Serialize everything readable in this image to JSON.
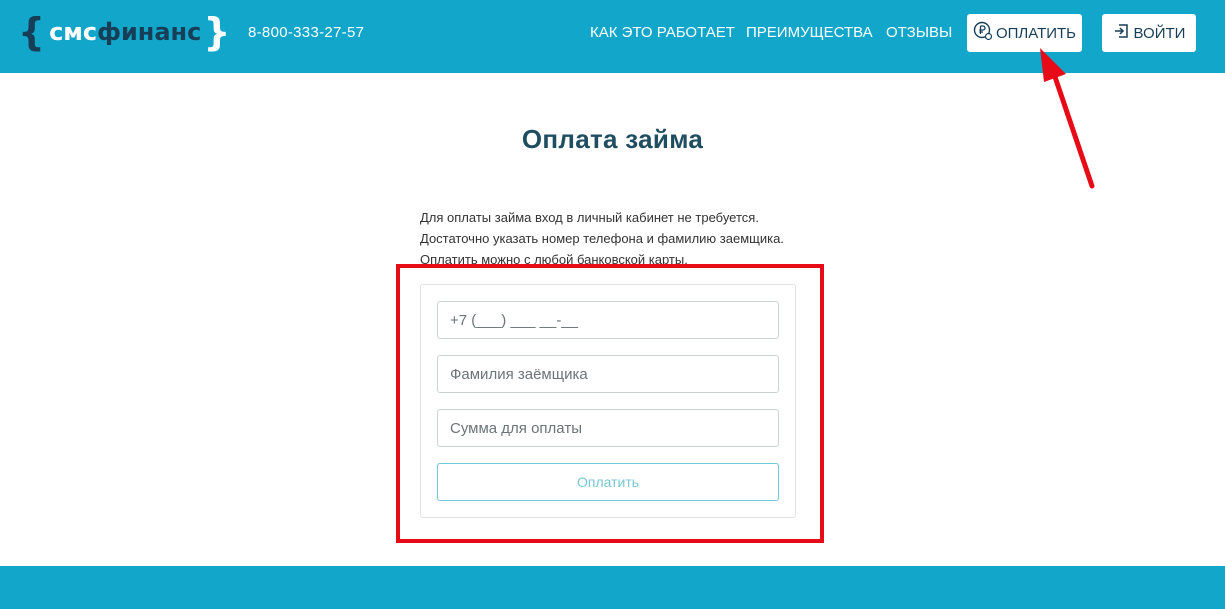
{
  "header": {
    "logo": {
      "open_brace": "{",
      "word_light": "смс",
      "word_dark": "финанс",
      "close_brace": "}"
    },
    "phone": "8-800-333-27-57",
    "nav": [
      {
        "label": "КАК ЭТО РАБОТАЕТ"
      },
      {
        "label": "ПРЕИМУЩЕСТВА"
      },
      {
        "label": "ОТЗЫВЫ"
      }
    ],
    "pay_button": {
      "label": "ОПЛАТИТЬ",
      "icon": "ruble-coin-icon"
    },
    "login_button": {
      "label": "ВОЙТИ",
      "icon": "login-icon"
    }
  },
  "main": {
    "title": "Оплата займа",
    "description": [
      "Для оплаты займа вход в личный кабинет не требуется.",
      "Достаточно указать номер телефона и фамилию заемщика.",
      "Оплатить можно с любой банковской карты."
    ],
    "form": {
      "phone_placeholder": "+7 (___) ___ __-__",
      "surname_placeholder": "Фамилия заёмщика",
      "amount_placeholder": "Сумма для оплаты",
      "submit_label": "Оплатить"
    }
  },
  "colors": {
    "header_bg": "#12a6ca",
    "brand_dark": "#173e57",
    "title": "#1f4e60",
    "annotation_red": "#e60b17",
    "button_outline": "#6fcbd6"
  }
}
